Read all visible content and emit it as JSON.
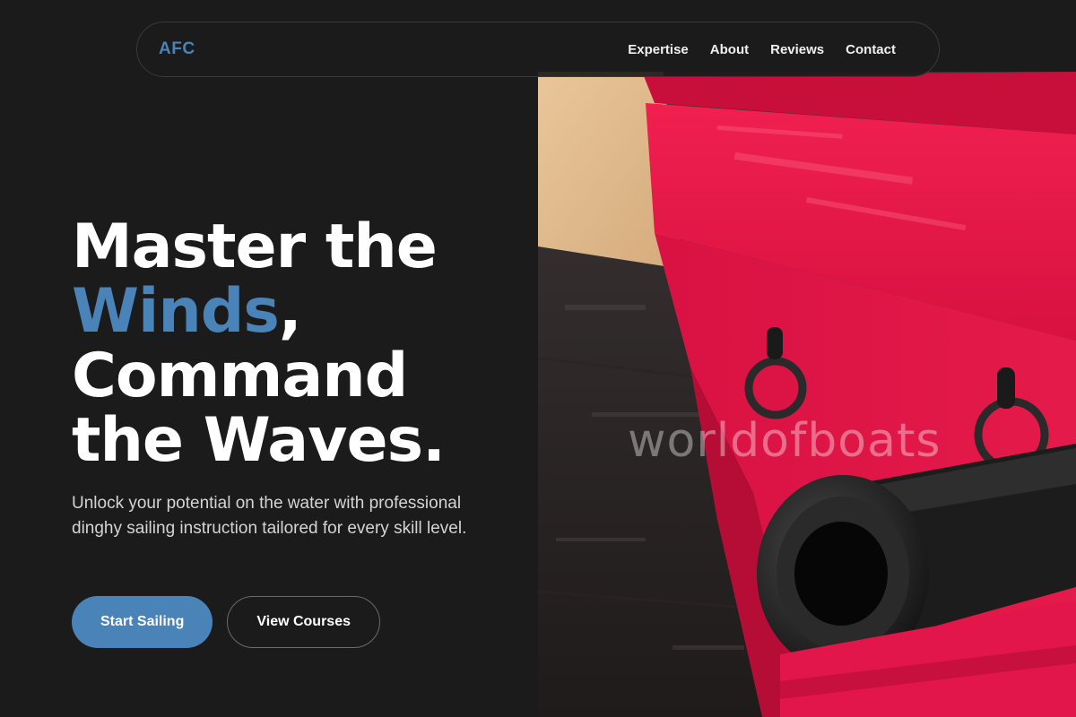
{
  "brand": {
    "logo": "AFC",
    "accent_color": "#4a83b8"
  },
  "nav": {
    "items": [
      {
        "label": "Expertise"
      },
      {
        "label": "About"
      },
      {
        "label": "Reviews"
      },
      {
        "label": "Contact"
      }
    ]
  },
  "hero": {
    "headline": {
      "line1": "Master the",
      "accent_word": "Winds",
      "comma": ",",
      "line3": "Command",
      "line4": "the Waves."
    },
    "subtitle": "Unlock your potential on the water with professional dinghy sailing instruction tailored for every skill level.",
    "primary_button": "Start Sailing",
    "secondary_button": "View Courses",
    "image": {
      "subject": "red-painted ship cannon carriage with black cannon barrel",
      "watermark": "worldofboats"
    }
  }
}
